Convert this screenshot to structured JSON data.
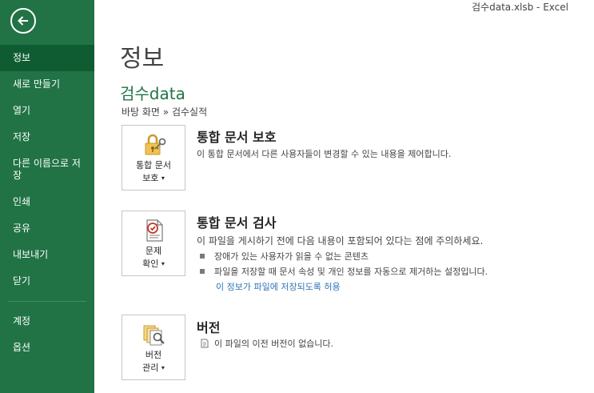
{
  "window": {
    "title": "검수data.xlsb - Excel"
  },
  "sidebar": {
    "back_icon": "back-arrow-icon",
    "items": [
      {
        "label": "정보",
        "selected": true
      },
      {
        "label": "새로 만들기"
      },
      {
        "label": "열기"
      },
      {
        "label": "저장"
      },
      {
        "label": "다른 이름으로 저장"
      },
      {
        "label": "인쇄"
      },
      {
        "label": "공유"
      },
      {
        "label": "내보내기"
      },
      {
        "label": "닫기"
      }
    ],
    "bottom_items": [
      {
        "label": "계정"
      },
      {
        "label": "옵션"
      }
    ]
  },
  "main": {
    "page_title": "정보",
    "file_name": "검수data",
    "breadcrumb": "바탕 화면 » 검수실적",
    "protect": {
      "button_line1": "통합 문서",
      "button_line2": "보호",
      "icon": "lock-key-icon",
      "title": "통합 문서 보호",
      "description": "이 통합 문서에서 다른 사용자들이 변경할 수 있는 내용을 제어합니다."
    },
    "inspect": {
      "button_line1": "문제",
      "button_line2": "확인",
      "icon": "inspect-document-icon",
      "title": "통합 문서 검사",
      "description": "이 파일을 게시하기 전에 다음 내용이 포함되어 있다는 점에 주의하세요.",
      "bullets": [
        "장애가 있는 사용자가 읽을 수 없는 콘텐츠",
        "파일을 저장할 때 문서 속성 및 개인 정보를 자동으로 제거하는 설정입니다."
      ],
      "link": "이 정보가 파일에 저장되도록 허용"
    },
    "versions": {
      "button_line1": "버전",
      "button_line2": "관리",
      "icon": "versions-icon",
      "title": "버전",
      "description": "이 파일의 이전 버전이 없습니다."
    }
  },
  "colors": {
    "sidebar": "#217346",
    "sidebar_selected": "#0f5c33",
    "accent_green": "#217346",
    "link": "#2e75b6"
  }
}
